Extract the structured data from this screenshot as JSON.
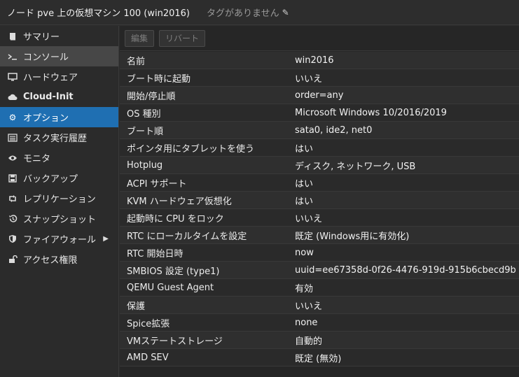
{
  "header": {
    "title": "ノード pve 上の仮想マシン 100 (win2016)",
    "tags": "タグがありません"
  },
  "sidebar": {
    "items": [
      {
        "label": "サマリー",
        "icon": "book-icon",
        "state": "normal"
      },
      {
        "label": "コンソール",
        "icon": "terminal-icon",
        "state": "hover"
      },
      {
        "label": "ハードウェア",
        "icon": "monitor-icon",
        "state": "normal"
      },
      {
        "label": "Cloud-Init",
        "icon": "cloud-icon",
        "state": "normal"
      },
      {
        "label": "オプション",
        "icon": "gear-icon",
        "state": "active"
      },
      {
        "label": "タスク実行履歴",
        "icon": "list-icon",
        "state": "normal"
      },
      {
        "label": "モニタ",
        "icon": "eye-icon",
        "state": "normal"
      },
      {
        "label": "バックアップ",
        "icon": "floppy-icon",
        "state": "normal"
      },
      {
        "label": "レプリケーション",
        "icon": "retweet-icon",
        "state": "normal"
      },
      {
        "label": "スナップショット",
        "icon": "history-icon",
        "state": "normal"
      },
      {
        "label": "ファイアウォール",
        "icon": "shield-icon",
        "state": "normal"
      },
      {
        "label": "アクセス権限",
        "icon": "unlock-icon",
        "state": "normal"
      }
    ]
  },
  "toolbar": {
    "edit_label": "編集",
    "revert_label": "リバート"
  },
  "options": [
    {
      "key": "名前",
      "value": "win2016"
    },
    {
      "key": "ブート時に起動",
      "value": "いいえ"
    },
    {
      "key": "開始/停止順",
      "value": "order=any"
    },
    {
      "key": "OS 種別",
      "value": "Microsoft Windows 10/2016/2019"
    },
    {
      "key": "ブート順",
      "value": "sata0, ide2, net0"
    },
    {
      "key": "ポインタ用にタブレットを使う",
      "value": "はい"
    },
    {
      "key": "Hotplug",
      "value": "ディスク, ネットワーク, USB"
    },
    {
      "key": "ACPI サポート",
      "value": "はい"
    },
    {
      "key": "KVM ハードウェア仮想化",
      "value": "はい"
    },
    {
      "key": "起動時に CPU をロック",
      "value": "いいえ"
    },
    {
      "key": "RTC にローカルタイムを設定",
      "value": "既定 (Windows用に有効化)"
    },
    {
      "key": "RTC 開始日時",
      "value": "now"
    },
    {
      "key": "SMBIOS 設定 (type1)",
      "value": "uuid=ee67358d-0f26-4476-919d-915b6cbecd9b"
    },
    {
      "key": "QEMU Guest Agent",
      "value": "有効"
    },
    {
      "key": "保護",
      "value": "いいえ"
    },
    {
      "key": "Spice拡張",
      "value": "none"
    },
    {
      "key": "VMステートストレージ",
      "value": "自動的"
    },
    {
      "key": "AMD SEV",
      "value": "既定 (無効)"
    }
  ]
}
